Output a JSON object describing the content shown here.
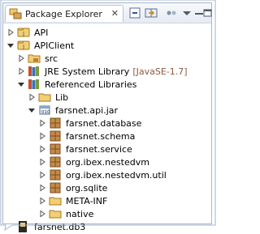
{
  "view": {
    "title": "Package Explorer",
    "close_glyph": "✕",
    "toolbar": [
      "collapse-all-icon",
      "link-with-editor-icon",
      "view-menu-icon",
      "minimize-icon",
      "maximize-icon"
    ]
  },
  "tree": [
    {
      "label": "API",
      "icon": "java-project-icon",
      "twisty": "collapsed",
      "level": 0
    },
    {
      "label": "APIClient",
      "icon": "java-project-icon",
      "twisty": "expanded",
      "level": 0
    },
    {
      "label": "src",
      "icon": "source-folder-icon",
      "twisty": "collapsed",
      "level": 1
    },
    {
      "label": "JRE System Library",
      "suffix": "[JavaSE-1.7]",
      "icon": "library-icon",
      "twisty": "collapsed",
      "level": 1
    },
    {
      "label": "Referenced Libraries",
      "icon": "library-icon",
      "twisty": "expanded",
      "level": 1
    },
    {
      "label": "Lib",
      "icon": "folder-icon",
      "twisty": "collapsed",
      "level": 2
    },
    {
      "label": "farsnet.api.jar",
      "icon": "jar-icon",
      "twisty": "expanded",
      "level": 2
    },
    {
      "label": "farsnet.database",
      "icon": "package-icon",
      "twisty": "collapsed",
      "level": 3
    },
    {
      "label": "farsnet.schema",
      "icon": "package-icon",
      "twisty": "collapsed",
      "level": 3
    },
    {
      "label": "farsnet.service",
      "icon": "package-icon",
      "twisty": "collapsed",
      "level": 3
    },
    {
      "label": "org.ibex.nestedvm",
      "icon": "package-icon",
      "twisty": "collapsed",
      "level": 3
    },
    {
      "label": "org.ibex.nestedvm.util",
      "icon": "package-icon",
      "twisty": "collapsed",
      "level": 3
    },
    {
      "label": "org.sqlite",
      "icon": "package-icon",
      "twisty": "collapsed",
      "level": 3
    },
    {
      "label": "META-INF",
      "icon": "folder-icon",
      "twisty": "collapsed",
      "level": 3
    },
    {
      "label": "native",
      "icon": "folder-icon",
      "twisty": "collapsed",
      "level": 3
    },
    {
      "label": "farsnet.db3",
      "icon": "file-icon",
      "twisty": "none",
      "level": 0
    }
  ],
  "colors": {
    "accent": "#2b579a",
    "folder": "#e8b64a",
    "package": "#b07a3c",
    "suffix": "#8a5a3a"
  }
}
